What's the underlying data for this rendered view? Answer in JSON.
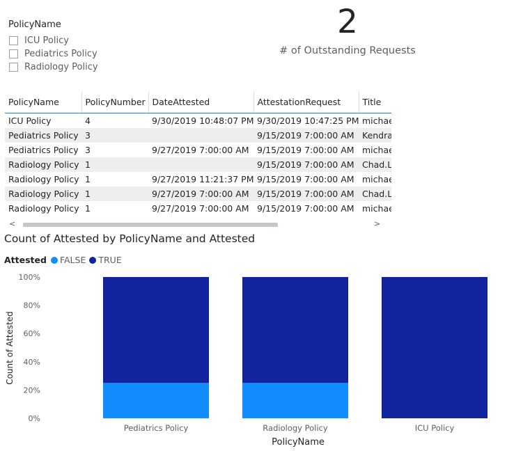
{
  "slicer": {
    "title": "PolicyName",
    "items": [
      "ICU Policy",
      "Pediatrics Policy",
      "Radiology Policy"
    ]
  },
  "card": {
    "value": "2",
    "label": "# of Outstanding Requests"
  },
  "table": {
    "columns": [
      "PolicyName",
      "PolicyNumber",
      "DateAttested",
      "AttestationRequest",
      "Title"
    ],
    "rows": [
      [
        "ICU Policy",
        "4",
        "9/30/2019 10:48:07 PM",
        "9/30/2019 10:47:25 PM",
        "michae"
      ],
      [
        "Pediatrics Policy",
        "3",
        "",
        "9/15/2019 7:00:00 AM",
        "Kendra"
      ],
      [
        "Pediatrics Policy",
        "3",
        "9/27/2019 7:00:00 AM",
        "9/15/2019 7:00:00 AM",
        "michae"
      ],
      [
        "Radiology Policy",
        "1",
        "",
        "9/15/2019 7:00:00 AM",
        "Chad.L"
      ],
      [
        "Radiology Policy",
        "1",
        "9/27/2019 11:21:37 PM",
        "9/15/2019 7:00:00 AM",
        "michae"
      ],
      [
        "Radiology Policy",
        "1",
        "9/27/2019 7:00:00 AM",
        "9/15/2019 7:00:00 AM",
        "Chad.L"
      ],
      [
        "Radiology Policy",
        "1",
        "9/27/2019 7:00:00 AM",
        "9/15/2019 7:00:00 AM",
        "michae"
      ]
    ],
    "scroll_left": "<",
    "scroll_right": ">"
  },
  "legend": {
    "title": "Attested",
    "items": [
      {
        "label": "FALSE",
        "color": "#118dff"
      },
      {
        "label": "TRUE",
        "color": "#12239e"
      }
    ]
  },
  "chart_data": {
    "type": "bar",
    "stacked": "100%",
    "title": "Count of Attested by PolicyName and Attested",
    "categories": [
      "Pediatrics Policy",
      "Radiology Policy",
      "ICU Policy"
    ],
    "series": [
      {
        "name": "FALSE",
        "color": "#118dff",
        "values": [
          25,
          25,
          0
        ]
      },
      {
        "name": "TRUE",
        "color": "#12239e",
        "values": [
          75,
          75,
          100
        ]
      }
    ],
    "yticks": [
      "0%",
      "20%",
      "40%",
      "60%",
      "80%",
      "100%"
    ],
    "ylim": [
      0,
      100
    ],
    "xlabel": "PolicyName",
    "ylabel": "Count of Attested",
    "grid": false,
    "legend_position": "top-left"
  }
}
